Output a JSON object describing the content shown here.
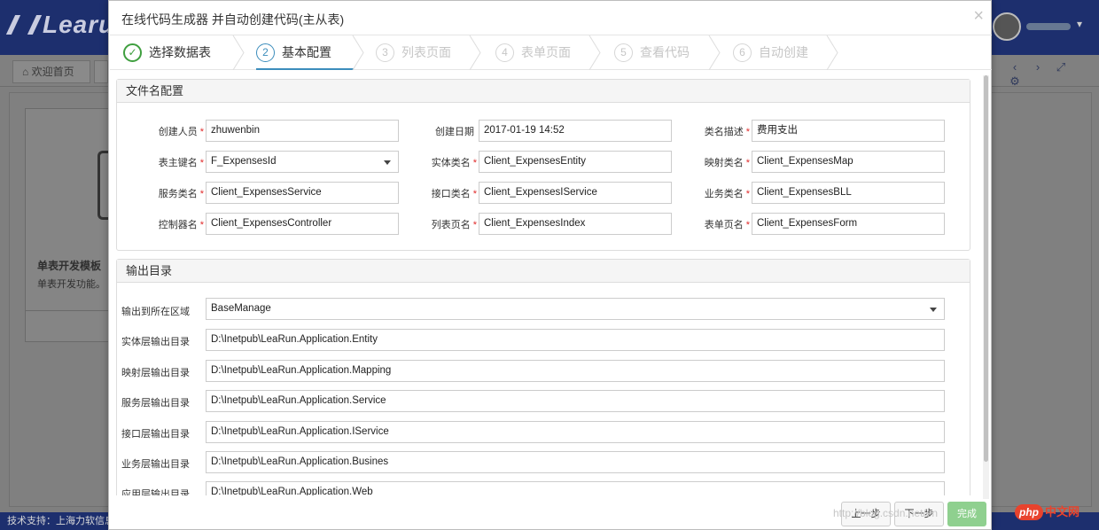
{
  "background": {
    "tab_home_label": "欢迎首页",
    "card_title": "单表开发模板",
    "card_desc": "单表开发功能。",
    "footer_text": "技术支持：上海力软信息",
    "watermark_text": "http://blog.csdn.net/en",
    "php_badge": "php",
    "php_badge_cn": "中文网"
  },
  "modal": {
    "title": "在线代码生成器 并自动创建代码(主从表)",
    "close_symbol": "×"
  },
  "wizard": {
    "steps": [
      {
        "num": "✓",
        "label": "选择数据表",
        "state": "done"
      },
      {
        "num": "2",
        "label": "基本配置",
        "state": "active"
      },
      {
        "num": "3",
        "label": "列表页面",
        "state": "pending"
      },
      {
        "num": "4",
        "label": "表单页面",
        "state": "pending"
      },
      {
        "num": "5",
        "label": "查看代码",
        "state": "pending"
      },
      {
        "num": "6",
        "label": "自动创建",
        "state": "pending"
      }
    ]
  },
  "file_config": {
    "heading": "文件名配置",
    "rows": [
      [
        {
          "label": "创建人员",
          "required": "*",
          "value": "zhuwenbin"
        },
        {
          "label": "创建日期",
          "required": "",
          "value": "2017-01-19 14:52"
        },
        {
          "label": "类名描述",
          "required": "*",
          "value": "费用支出"
        }
      ],
      [
        {
          "label": "表主键名",
          "required": "*",
          "value": "F_ExpensesId"
        },
        {
          "label": "实体类名",
          "required": "*",
          "value": "Client_ExpensesEntity"
        },
        {
          "label": "映射类名",
          "required": "*",
          "value": "Client_ExpensesMap"
        }
      ],
      [
        {
          "label": "服务类名",
          "required": "*",
          "value": "Client_ExpensesService"
        },
        {
          "label": "接口类名",
          "required": "*",
          "value": "Client_ExpensesIService"
        },
        {
          "label": "业务类名",
          "required": "*",
          "value": "Client_ExpensesBLL"
        }
      ],
      [
        {
          "label": "控制器名",
          "required": "*",
          "value": "Client_ExpensesController"
        },
        {
          "label": "列表页名",
          "required": "*",
          "value": "Client_ExpensesIndex"
        },
        {
          "label": "表单页名",
          "required": "*",
          "value": "Client_ExpensesForm"
        }
      ]
    ]
  },
  "output_dir": {
    "heading": "输出目录",
    "rows": [
      {
        "label": "输出到所在区域",
        "value": "BaseManage"
      },
      {
        "label": "实体层输出目录",
        "value": "D:\\Inetpub\\LeaRun.Application.Entity"
      },
      {
        "label": "映射层输出目录",
        "value": "D:\\Inetpub\\LeaRun.Application.Mapping"
      },
      {
        "label": "服务层输出目录",
        "value": "D:\\Inetpub\\LeaRun.Application.Service"
      },
      {
        "label": "接口层输出目录",
        "value": "D:\\Inetpub\\LeaRun.Application.IService"
      },
      {
        "label": "业务层输出目录",
        "value": "D:\\Inetpub\\LeaRun.Application.Busines"
      },
      {
        "label": "应用层输出目录",
        "value": "D:\\Inetpub\\LeaRun.Application.Web"
      }
    ]
  },
  "buttons": {
    "prev": "上一步",
    "next": "下一步",
    "finish": "完成"
  }
}
